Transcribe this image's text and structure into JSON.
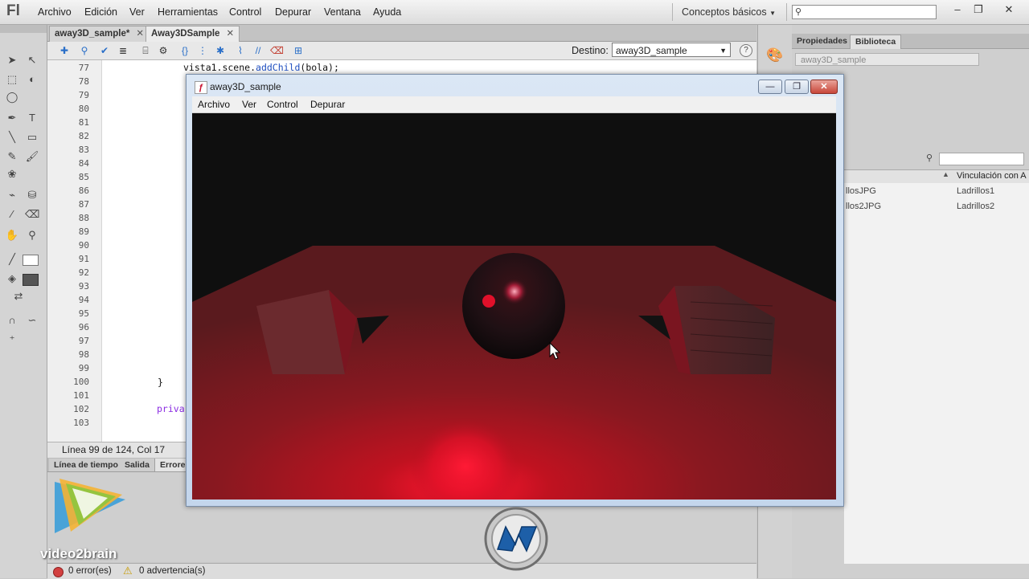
{
  "app": {
    "logo": "Fl",
    "menu": [
      "Archivo",
      "Edición",
      "Ver",
      "Herramientas",
      "Control",
      "Depurar",
      "Ventana",
      "Ayuda"
    ],
    "workspace": "Conceptos básicos",
    "window_controls": [
      "–",
      "❐",
      "✕"
    ]
  },
  "tabs": [
    "away3D_sample*",
    "Away3DSample"
  ],
  "toolbar": {
    "target_label": "Destino:",
    "target_value": "away3D_sample",
    "help": "?"
  },
  "editor": {
    "line_numbers": [
      "77",
      "78",
      "79",
      "80",
      "81",
      "82",
      "83",
      "84",
      "85",
      "86",
      "87",
      "88",
      "89",
      "90",
      "91",
      "92",
      "93",
      "94",
      "95",
      "96",
      "97",
      "98",
      "99",
      "100",
      "101",
      "102",
      "103"
    ],
    "code_line_77": "vista1.scene.",
    "code_line_77_fn": "addChild",
    "code_line_77_end": "(bola);",
    "code_line_100": "}",
    "code_line_102_kw": "priva"
  },
  "status": "Línea 99 de 124, Col 17",
  "bottom_tabs": [
    "Línea de tiempo",
    "Salida",
    "Errores"
  ],
  "errors": {
    "errors": "0 error(es)",
    "warnings": "0 advertencia(s)"
  },
  "right_panel": {
    "tabs": [
      "Propiedades",
      "Biblioteca"
    ],
    "library_select": "away3D_sample",
    "column": "Vinculación con A",
    "items": [
      {
        "name": "llosJPG",
        "linkage": "Ladrillos1"
      },
      {
        "name": "llos2JPG",
        "linkage": "Ladrillos2"
      }
    ]
  },
  "swf": {
    "title": "away3D_sample",
    "menu": [
      "Archivo",
      "Ver",
      "Control",
      "Depurar"
    ],
    "buttons": [
      "—",
      "❐",
      "✕"
    ]
  },
  "watermark": {
    "brand": "video2brain"
  },
  "colors": {
    "accent": "#c8102e",
    "stage_floor": "#8b1a1f"
  }
}
